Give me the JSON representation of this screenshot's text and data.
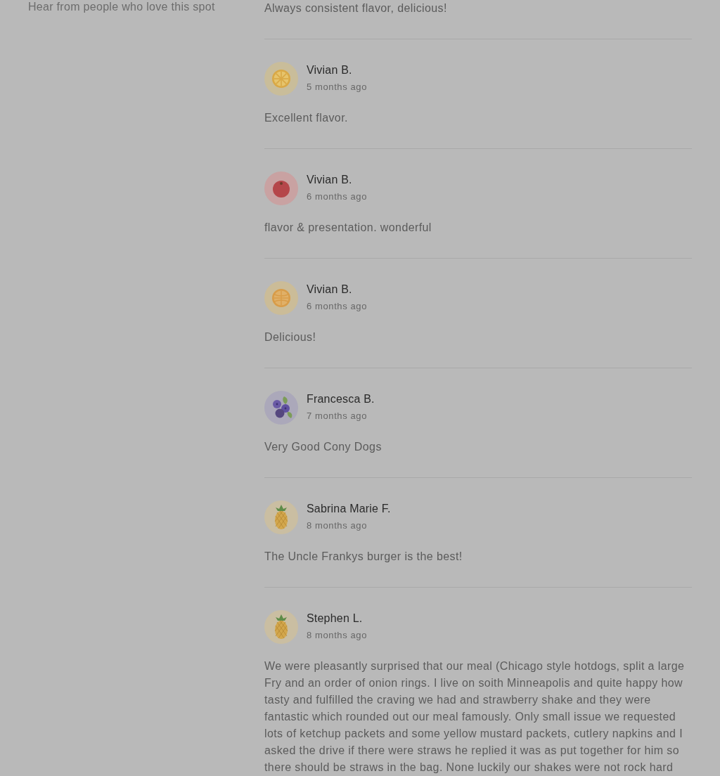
{
  "sidebar": {
    "heading": "Hear from people who love this spot"
  },
  "partial_review": {
    "text": "Always consistent flavor, delicious!"
  },
  "reviews": [
    {
      "name": "Vivian B.",
      "time": "5 months ago",
      "text": "Excellent flavor.",
      "avatar": {
        "kind": "lemon"
      }
    },
    {
      "name": "Vivian B.",
      "time": "6 months ago",
      "text": "flavor & presentation. wonderful",
      "avatar": {
        "kind": "tomato"
      }
    },
    {
      "name": "Vivian B.",
      "time": "6 months ago",
      "text": "Delicious!",
      "avatar": {
        "kind": "orange"
      }
    },
    {
      "name": "Francesca B.",
      "time": "7 months ago",
      "text": "Very Good Cony Dogs",
      "avatar": {
        "kind": "blueberry"
      }
    },
    {
      "name": "Sabrina Marie F.",
      "time": "8 months ago",
      "text": "The Uncle Frankys burger is the best!",
      "avatar": {
        "kind": "pineapple"
      }
    },
    {
      "name": "Stephen L.",
      "time": "8 months ago",
      "text": "We were pleasantly surprised that our meal (Chicago style hotdogs, split a large Fry and an order of onion rings. I live on soith Minneapolis and quite happy how tasty and fulfilled the craving we had and strawberry shake and they were fantastic which rounded out our meal famously. Only small issue we requested lots of ketchup packets and some yellow mustard packets, cutlery napkins and I asked the drive if there were straws he replied it was as put together for him so there should be straws in the bag. None luckily our shakes were not rock hard",
      "avatar": {
        "kind": "pineapple"
      }
    }
  ]
}
